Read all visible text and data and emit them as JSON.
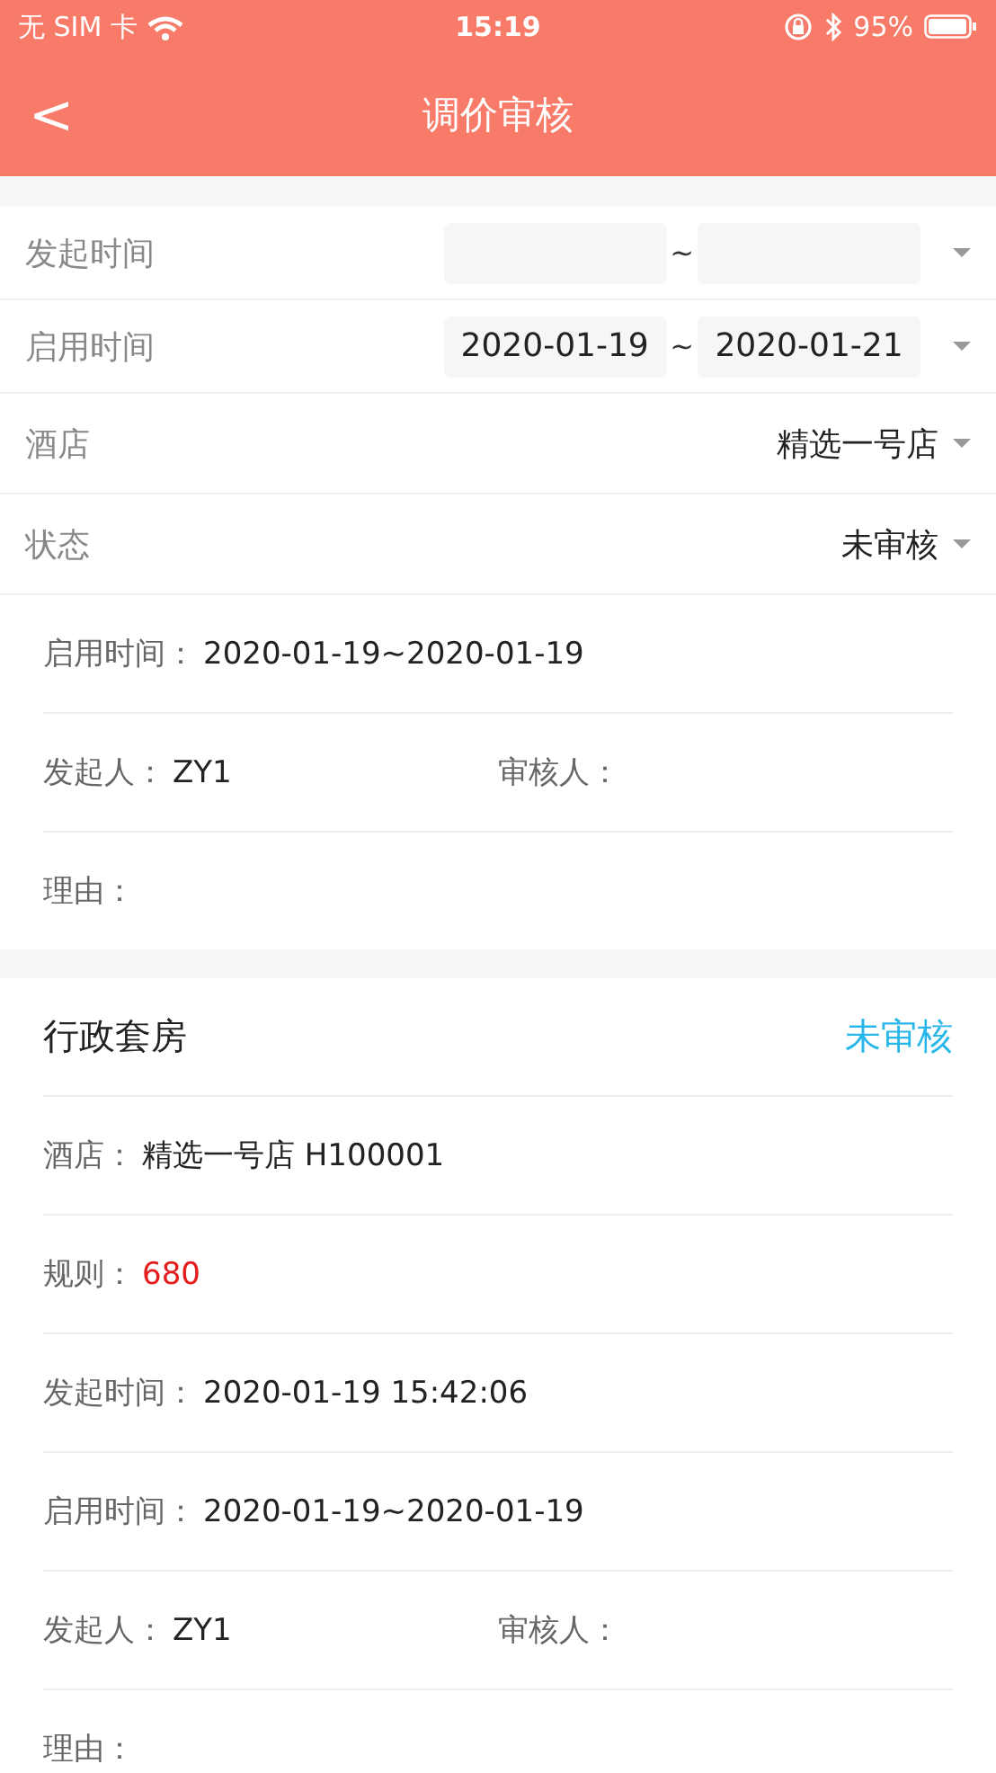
{
  "status_bar": {
    "carrier": "无 SIM 卡",
    "time": "15:19",
    "battery": "95%"
  },
  "nav": {
    "back": "<",
    "title": "调价审核"
  },
  "filters": [
    {
      "kind": "date-range",
      "label": "发起时间",
      "separator": "~"
    },
    {
      "kind": "date-range",
      "label": "启用时间",
      "from": "2020-01-19",
      "separator": "~",
      "to": "2020-01-21"
    },
    {
      "kind": "select",
      "label": "酒店",
      "value": "精选一号店"
    },
    {
      "kind": "select",
      "label": "状态",
      "value": "未审核"
    }
  ],
  "cards": [
    {
      "rows": [
        {
          "kind": "single",
          "label": "启用时间：",
          "value": "2020-01-19~2020-01-19"
        },
        {
          "kind": "pair",
          "fields": [
            {
              "label": "发起人：",
              "value": "ZY1"
            },
            {
              "label": "审核人："
            }
          ]
        },
        {
          "kind": "single",
          "label": "理由："
        }
      ]
    },
    {
      "title": "行政套房",
      "status": "未审核",
      "rows": [
        {
          "kind": "single",
          "label": "酒店：",
          "value": "精选一号店 H100001"
        },
        {
          "kind": "price",
          "label": "规则：",
          "value": "680"
        },
        {
          "kind": "single",
          "label": "发起时间：",
          "value": "2020-01-19 15:42:06"
        },
        {
          "kind": "single",
          "label": "启用时间：",
          "value": "2020-01-19~2020-01-19"
        },
        {
          "kind": "pair",
          "fields": [
            {
              "label": "发起人：",
              "value": "ZY1"
            },
            {
              "label": "审核人："
            }
          ]
        },
        {
          "kind": "single",
          "label": "理由："
        }
      ]
    }
  ]
}
